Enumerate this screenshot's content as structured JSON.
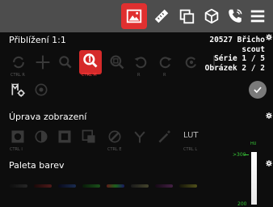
{
  "topbar": {
    "buttons": [
      {
        "name": "image-icon",
        "active": true
      },
      {
        "name": "ruler-icon",
        "active": false
      },
      {
        "name": "copy-icon",
        "active": false
      },
      {
        "name": "cube-icon",
        "active": false
      },
      {
        "name": "phone-icon",
        "active": false
      },
      {
        "name": "menu-icon",
        "active": false
      }
    ],
    "accent_color": "#e03030"
  },
  "sections": {
    "zoom": {
      "title": "Přiblížení 1:1"
    },
    "display": {
      "title": "Úprava zobrazení"
    },
    "palette": {
      "title": "Paleta barev"
    }
  },
  "info": {
    "patient_line1": "20527 Břicho",
    "patient_line2": "scout",
    "series": "Série 1 / 5",
    "image": "Obrázek 2 / 2"
  },
  "zoom_tools": {
    "labels": {
      "ctrl_r": "CTRL R",
      "ctrl_m": "CTRL M",
      "r1": "R",
      "r2": "R"
    }
  },
  "display_tools": {
    "lut_label": "LUT",
    "labels": {
      "ctrl_i": "CTRL I",
      "ctrl_e": "CTRL E",
      "ctrl_l": "CTRL L"
    }
  },
  "hu_scale": {
    "unit": "HU",
    "max": ">300",
    "min": "200"
  }
}
